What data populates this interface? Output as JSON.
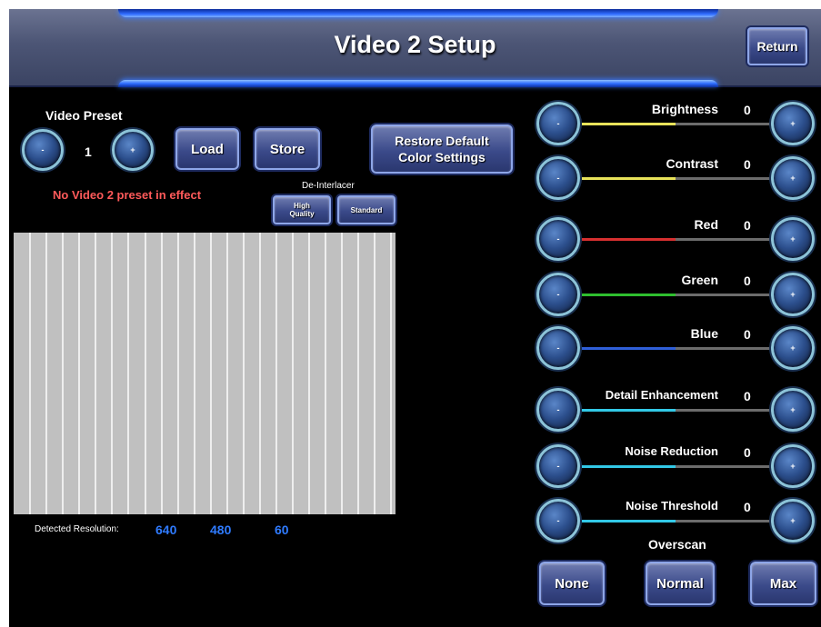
{
  "header": {
    "title": "Video 2 Setup",
    "return_label": "Return"
  },
  "preset": {
    "label": "Video Preset",
    "minus": "-",
    "value": "1",
    "plus": "+",
    "load": "Load",
    "store": "Store",
    "restore_line1": "Restore Default",
    "restore_line2": "Color Settings",
    "status": "No Video 2 preset in effect"
  },
  "deinterlacer": {
    "label": "De-Interlacer",
    "high_quality_line1": "High",
    "high_quality_line2": "Quality",
    "standard": "Standard"
  },
  "resolution": {
    "label": "Detected Resolution:",
    "width": "640",
    "height": "480",
    "rate": "60"
  },
  "sliders": [
    {
      "label": "Brightness",
      "value": "0",
      "color": "#e8e35a"
    },
    {
      "label": "Contrast",
      "value": "0",
      "color": "#e8e35a"
    },
    {
      "label": "Red",
      "value": "0",
      "color": "#d83030"
    },
    {
      "label": "Green",
      "value": "0",
      "color": "#2fbf2f"
    },
    {
      "label": "Blue",
      "value": "0",
      "color": "#2f5fd8"
    },
    {
      "label": "Detail Enhancement",
      "value": "0",
      "color": "#32c8e6"
    },
    {
      "label": "Noise Reduction",
      "value": "0",
      "color": "#32c8e6"
    },
    {
      "label": "Noise Threshold",
      "value": "0",
      "color": "#32c8e6"
    }
  ],
  "slider_level": 0.49,
  "slider_buttons": {
    "minus": "-",
    "plus": "+"
  },
  "overscan": {
    "label": "Overscan",
    "none": "None",
    "normal": "Normal",
    "max": "Max"
  },
  "colors": {
    "status_text": "#ff5a5a",
    "resolution_values": "#2f7bff",
    "panel_bg": "#000000"
  }
}
